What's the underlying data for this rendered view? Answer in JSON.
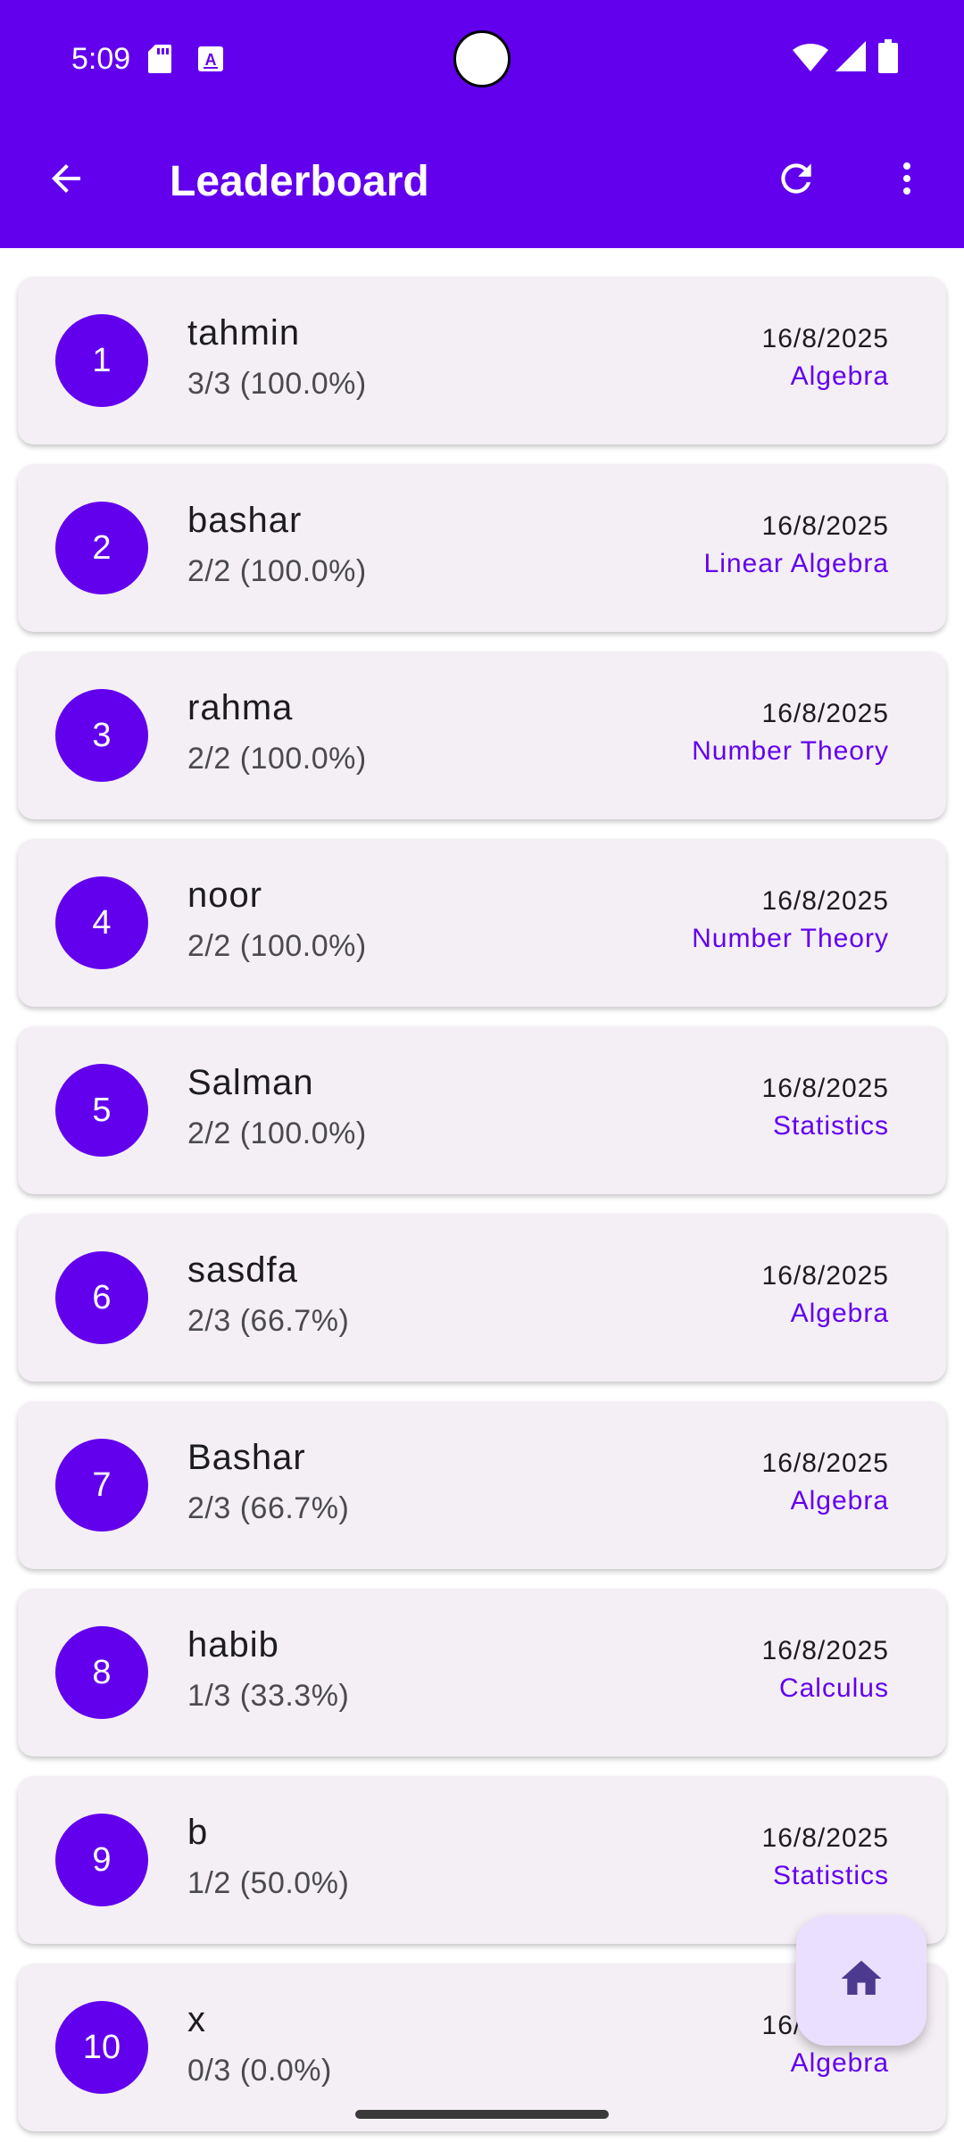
{
  "status_bar": {
    "time": "5:09"
  },
  "app_bar": {
    "title": "Leaderboard"
  },
  "colors": {
    "primary": "#6200ee",
    "card_bg": "#f4eff5",
    "fab_bg": "#ebdfff",
    "fab_icon": "#4b3a8f"
  },
  "icons": {
    "back": "arrow-back-icon",
    "refresh": "refresh-icon",
    "more": "more-vert-icon",
    "home": "home-icon",
    "status": [
      "sd-card-icon",
      "a-icon",
      "wifi-icon",
      "signal-icon",
      "battery-icon"
    ]
  },
  "leaderboard": [
    {
      "rank": "1",
      "name": "tahmin",
      "score": "3/3 (100.0%)",
      "date": "16/8/2025",
      "topic": "Algebra"
    },
    {
      "rank": "2",
      "name": "bashar",
      "score": "2/2 (100.0%)",
      "date": "16/8/2025",
      "topic": "Linear Algebra"
    },
    {
      "rank": "3",
      "name": "rahma",
      "score": "2/2 (100.0%)",
      "date": "16/8/2025",
      "topic": "Number Theory"
    },
    {
      "rank": "4",
      "name": "noor",
      "score": "2/2 (100.0%)",
      "date": "16/8/2025",
      "topic": "Number Theory"
    },
    {
      "rank": "5",
      "name": "Salman",
      "score": "2/2 (100.0%)",
      "date": "16/8/2025",
      "topic": "Statistics"
    },
    {
      "rank": "6",
      "name": "sasdfa",
      "score": "2/3 (66.7%)",
      "date": "16/8/2025",
      "topic": "Algebra"
    },
    {
      "rank": "7",
      "name": "Bashar",
      "score": "2/3 (66.7%)",
      "date": "16/8/2025",
      "topic": "Algebra"
    },
    {
      "rank": "8",
      "name": "habib",
      "score": "1/3 (33.3%)",
      "date": "16/8/2025",
      "topic": "Calculus"
    },
    {
      "rank": "9",
      "name": "b",
      "score": "1/2 (50.0%)",
      "date": "16/8/2025",
      "topic": "Statistics"
    },
    {
      "rank": "10",
      "name": "x",
      "score": "0/3 (0.0%)",
      "date": "16/8/2025",
      "topic": "Algebra"
    }
  ]
}
